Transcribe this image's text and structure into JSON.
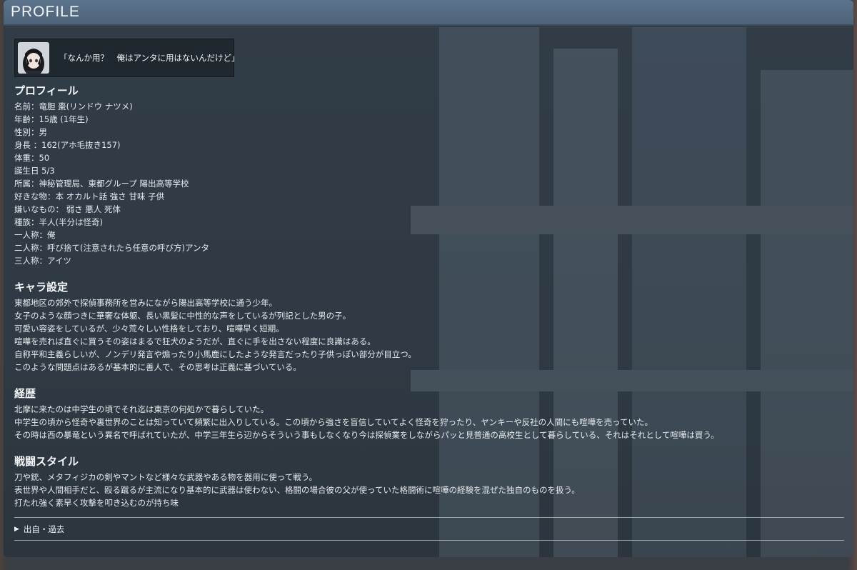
{
  "header": {
    "title": "PROFILE"
  },
  "quote": {
    "text": "「なんか用？　俺はアンタに用はないんだけど」"
  },
  "profile": {
    "title": "プロフィール",
    "lines": [
      "名前：竜胆 棗(リンドウ ナツメ)",
      "年齢：15歳 (1年生)",
      "性別：男",
      "身長 ：162(アホ毛抜き157)",
      "体重：50",
      "誕生日 5/3",
      "所属：神秘管理局、東都グループ 陽出高等学校",
      "好きな物：本 オカルト話 強さ 甘味 子供",
      "嫌いなもの： 弱さ 悪人 死体",
      "種族：半人(半分は怪奇)",
      "一人称：俺",
      "二人称：呼び捨て(注意されたら任意の呼び方)アンタ",
      "三人称：アイツ"
    ]
  },
  "character": {
    "title": "キャラ設定",
    "lines": [
      "東都地区の郊外で探偵事務所を営みにながら陽出高等学校に通う少年。",
      "女子のような顔つきに華奢な体躯、長い黒髪に中性的な声をしているが列記とした男の子。",
      "可愛い容姿をしているが、少々荒々しい性格をしており、喧嘩早く短期。",
      "喧嘩を売れば直ぐに買うその姿はまるで狂犬のようだが、直ぐに手を出さない程度に良識はある。",
      "自称平和主義らしいが、ノンデリ発言や煽ったり小馬鹿にしたような発言だったり子供っぽい部分が目立つ。",
      "このような問題点はあるが基本的に善人で、その思考は正義に基づいている。"
    ]
  },
  "history": {
    "title": "経歴",
    "lines": [
      "北摩に来たのは中学生の頃でそれ迄は東京の何処かで暮らしていた。",
      "中学生の頃から怪奇や裏世界のことは知っていて頻繁に出入りしている。この頃から強さを盲信していてよく怪奇を狩ったり、ヤンキーや反社の人間にも喧嘩を売っていた。",
      "その時は西の暴竜という異名で呼ばれていたが、中学三年生ら辺からそういう事もしなくなり今は探偵業をしながらパッと見普通の高校生として暮らしている、それはそれとして喧嘩は買う。"
    ]
  },
  "combat": {
    "title": "戦闘スタイル",
    "lines": [
      "刀や銃、メタフィジカの剣やマントなど様々な武器やある物を器用に使って戦う。",
      "表世界や人間相手だと、殴る蹴るが主流になり基本的に武器は使わない、格闘の場合彼の父が使っていた格闘術に喧嘩の経験を混ぜた独自のものを扱う。",
      "打たれ強く素早く攻撃を叩き込むのが持ち味"
    ]
  },
  "accordion": {
    "label": "出自・過去",
    "arrow": "▶"
  },
  "icons": {
    "avatar": "avatar-portrait",
    "accordion": "triangle-right-icon"
  },
  "colors": {
    "header": "#5b738c",
    "panel": "#313c47",
    "text": "#e8ecef"
  }
}
